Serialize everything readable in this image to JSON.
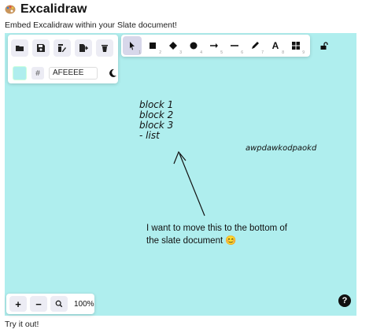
{
  "header": {
    "title": "Excalidraw",
    "subtitle": "Embed Excalidraw within your Slate document!"
  },
  "menu": {
    "buttons": [
      {
        "icon": "folder-open-icon"
      },
      {
        "icon": "save-icon"
      },
      {
        "icon": "save-as-icon"
      },
      {
        "icon": "export-icon"
      },
      {
        "icon": "trash-icon"
      }
    ],
    "background_hash": "#",
    "background_value": "AFEEEE",
    "theme_icon": "moon-icon"
  },
  "toolbar": {
    "tools": [
      {
        "name": "selection",
        "icon": "pointer-icon",
        "num": "1",
        "active": true
      },
      {
        "name": "rectangle",
        "icon": "square-icon",
        "num": "2"
      },
      {
        "name": "diamond",
        "icon": "diamond-icon",
        "num": "3"
      },
      {
        "name": "ellipse",
        "icon": "circle-icon",
        "num": "4"
      },
      {
        "name": "arrow",
        "icon": "arrow-right-icon",
        "num": "5"
      },
      {
        "name": "line",
        "icon": "line-icon",
        "num": "6"
      },
      {
        "name": "draw",
        "icon": "pencil-icon",
        "num": "7"
      },
      {
        "name": "text",
        "icon": "text-icon",
        "num": "8"
      },
      {
        "name": "library",
        "icon": "grid-icon",
        "num": "9"
      }
    ],
    "text_tool_label": "A",
    "lock_icon": "unlock-icon"
  },
  "canvas": {
    "background_color": "#afeeee",
    "block_lines": [
      "block 1",
      "block 2",
      "block 3",
      "- list"
    ],
    "scribble": "awpdawkodpaokd",
    "note_line1": "I want to move this to the bottom of",
    "note_line2": "the slate document 😊"
  },
  "zoom": {
    "zoom_in": "+",
    "zoom_out": "−",
    "value": "100%"
  },
  "help": "?",
  "footer": "Try it out!"
}
